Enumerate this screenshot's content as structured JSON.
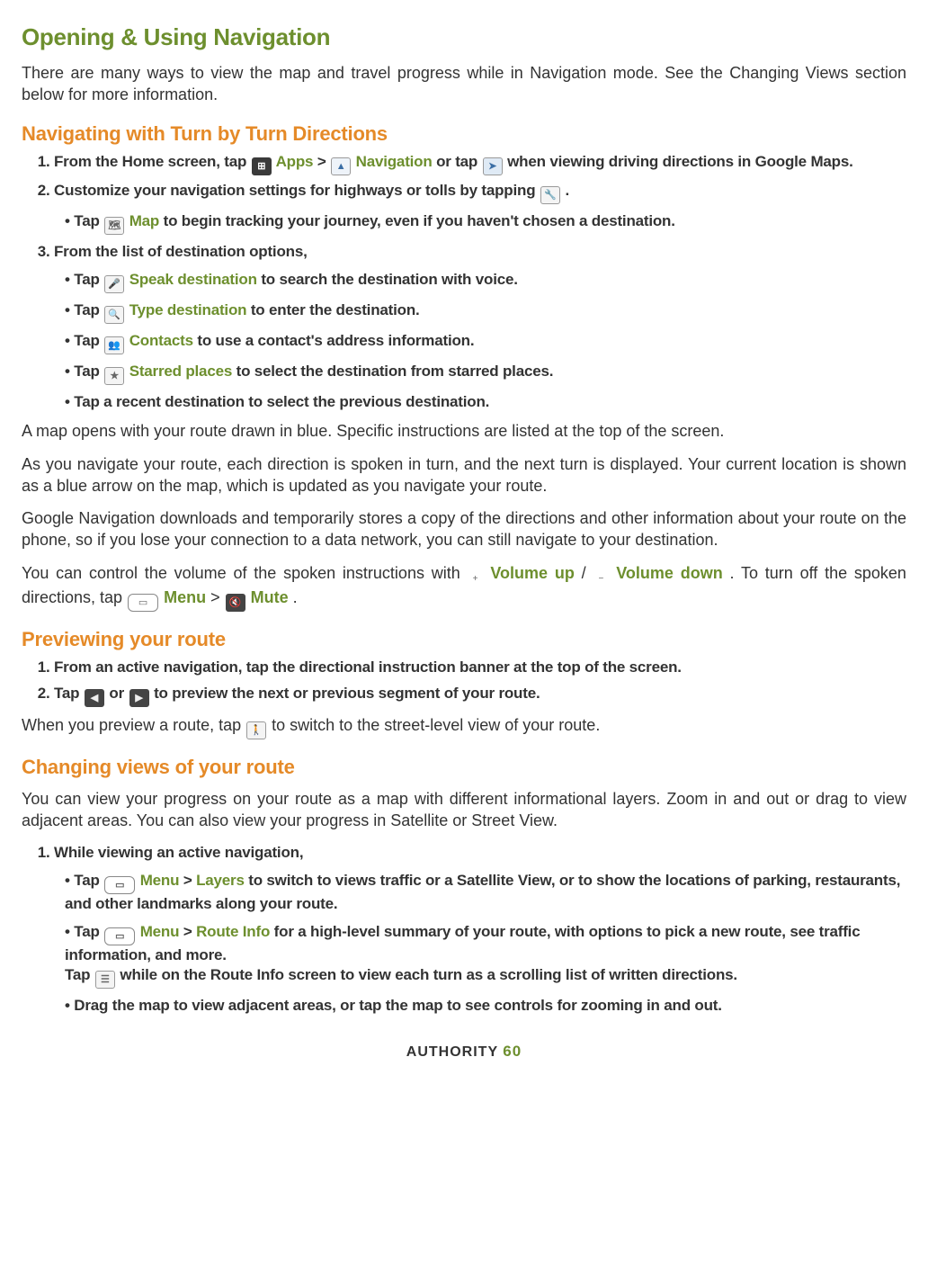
{
  "h1": "Opening & Using Navigation",
  "intro": "There are many ways to view the map and travel progress while in Navigation mode. See the Changing Views section below for more information.",
  "h2_nav": "Navigating with Turn by Turn Directions",
  "step1_a": "From the Home screen, tap ",
  "apps_label": "Apps",
  "step1_b": " > ",
  "navigation_label": "Navigation",
  "step1_c": " or tap ",
  "step1_d": " when viewing driving directions in Google Maps.",
  "step2_a": "Customize your navigation settings for highways or tolls by tapping ",
  "step2_b": " .",
  "step2_sub_a": "Tap ",
  "map_label": "Map",
  "step2_sub_b": " to begin tracking your journey, even if you haven't chosen a destination.",
  "step3": "From the list of destination options,",
  "speak_a": "Tap ",
  "speak_label": "Speak destination",
  "speak_b": " to search the destination with voice.",
  "type_a": "Tap ",
  "type_label": "Type destination",
  "type_b": " to enter the destination.",
  "contacts_a": "Tap ",
  "contacts_label": "Contacts",
  "contacts_b": " to use a contact's address information.",
  "starred_a": "Tap ",
  "starred_label": "Starred places",
  "starred_b": " to select the destination from starred places.",
  "recent": "Tap a recent destination to select the previous destination.",
  "p_map_opens": "A map opens with your route drawn in blue. Specific instructions are listed at the top of the screen.",
  "p_as_you_nav": "As you navigate your route, each direction is spoken in turn, and the next turn is displayed. Your current location is shown as a blue arrow on the map, which is updated as you navigate your route.",
  "p_google_nav": "Google Navigation downloads and temporarily stores a copy of the directions and other information about your route on the phone, so if you lose your connection to a data network, you can still navigate to your destination.",
  "p_vol_a": "You can control the volume of the spoken instructions with ",
  "vol_up": "Volume up",
  "p_vol_slash": " / ",
  "vol_down": "Volume down",
  "p_vol_b": ". To turn off the spoken directions, tap ",
  "menu_label": "Menu",
  "p_vol_gt": " > ",
  "mute_label": "Mute",
  "p_vol_c": ".",
  "h2_preview": "Previewing your route",
  "prev1": "From an active navigation, tap the directional instruction banner at the top of the screen.",
  "prev2_a": "Tap ",
  "prev2_b": " or ",
  "prev2_c": " to preview the next or previous segment of your route.",
  "p_when_preview_a": "When you preview a route, tap ",
  "p_when_preview_b": " to switch to the street-level view of your route.",
  "h2_changing": "Changing views of your route",
  "p_changing": "You can view your progress on your route as a map with different informational layers. Zoom in and out or drag to view adjacent areas. You can also view your progress in Satellite or Street View.",
  "cv1": "While viewing an active navigation,",
  "cv_layers_a": "Tap ",
  "cv_layers_gt": " > ",
  "layers_label": "Layers",
  "cv_layers_b": " to switch to views traffic or a Satellite View, or to show the locations of parking, restaurants, and other landmarks along your route.",
  "cv_route_a": "Tap ",
  "route_info_label": "Route Info",
  "cv_route_b": " for a high-level summary of your route, with options to pick a new route, see traffic information, and more.",
  "cv_route_c_a": "Tap ",
  "cv_route_c_b": " while on the Route Info screen to view each turn as a scrolling list of written directions.",
  "cv_drag": "Drag the map to view adjacent areas, or tap the map to see controls for zooming in and out.",
  "footer_brand": "AUTHORITY",
  "footer_page": "60"
}
